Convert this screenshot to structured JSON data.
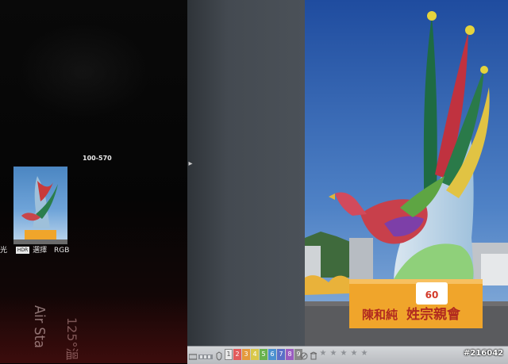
{
  "camera_screen": {
    "folder_number": "100-570",
    "info_label_left": "光",
    "info_box_text": "HDR",
    "info_select_label": "選擇",
    "info_color_space": "RGB"
  },
  "reflection": {
    "line1": "Air Sta",
    "line2": "125°溫"
  },
  "viewer": {
    "collapse_arrow": "▸",
    "labels": [
      "1",
      "2",
      "3",
      "4",
      "5",
      "6",
      "7",
      "8",
      "9"
    ],
    "label_colors": [
      "#ffffff",
      "#e35b5b",
      "#e59a3c",
      "#d9c84a",
      "#69b24e",
      "#4a90d0",
      "#5a6fc8",
      "#9a5cc0",
      "#888888"
    ],
    "stars": [
      "★",
      "★",
      "★",
      "★",
      "★"
    ],
    "photo_sign_left": "陳和純",
    "photo_sign_right": "姓宗親會",
    "photo_badge": "60",
    "watermark": "#216042"
  },
  "colors": {
    "sky_top": "#1f4c9f",
    "sky_bottom": "#8fb4dc",
    "pedestal": "#f0a52b"
  }
}
